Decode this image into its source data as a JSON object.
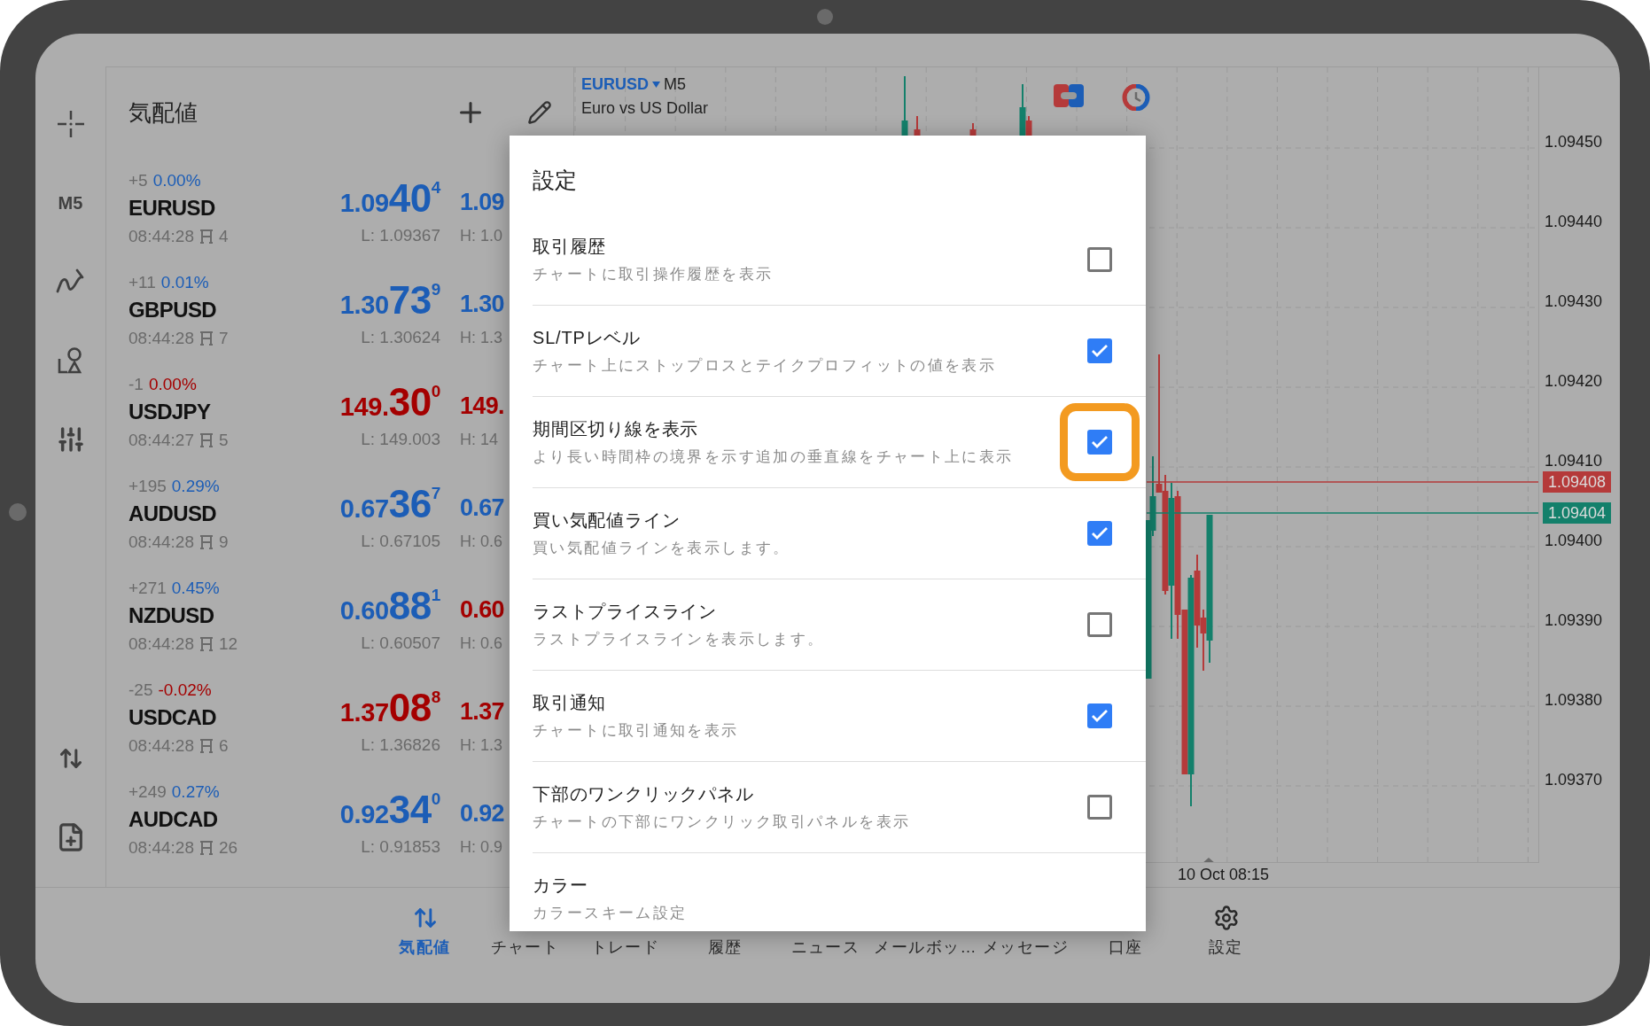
{
  "toolbar": {
    "timeframe": "M5"
  },
  "quotes": {
    "title": "気配値",
    "items": [
      {
        "symbol": "EURUSD",
        "change": {
          "points": "+5",
          "pct": "0.00%",
          "color": "#1c5db6"
        },
        "time": "08:44:28",
        "spread": "4",
        "bid": {
          "prefix": "1.09",
          "big": "40",
          "sup": "4",
          "color": "#1c5db6"
        },
        "low": "L: 1.09367",
        "ask": {
          "text": "1.09",
          "color": "#1c5db6"
        },
        "high": "H: 1.0"
      },
      {
        "symbol": "GBPUSD",
        "change": {
          "points": "+11",
          "pct": "0.01%",
          "color": "#1c5db6"
        },
        "time": "08:44:28",
        "spread": "7",
        "bid": {
          "prefix": "1.30",
          "big": "73",
          "sup": "9",
          "color": "#1c5db6"
        },
        "low": "L: 1.30624",
        "ask": {
          "text": "1.30",
          "color": "#1c5db6"
        },
        "high": "H: 1.3"
      },
      {
        "symbol": "USDJPY",
        "change": {
          "points": "-1",
          "pct": "0.00%",
          "color": "#a40000"
        },
        "time": "08:44:27",
        "spread": "5",
        "bid": {
          "prefix": "149.",
          "big": "30",
          "sup": "0",
          "color": "#a40000"
        },
        "low": "L: 149.003",
        "ask": {
          "text": "149.",
          "color": "#a40000"
        },
        "high": "H: 14"
      },
      {
        "symbol": "AUDUSD",
        "change": {
          "points": "+195",
          "pct": "0.29%",
          "color": "#1c5db6"
        },
        "time": "08:44:28",
        "spread": "9",
        "bid": {
          "prefix": "0.67",
          "big": "36",
          "sup": "7",
          "color": "#1c5db6"
        },
        "low": "L: 0.67105",
        "ask": {
          "text": "0.67",
          "color": "#1c5db6"
        },
        "high": "H: 0.6"
      },
      {
        "symbol": "NZDUSD",
        "change": {
          "points": "+271",
          "pct": "0.45%",
          "color": "#1c5db6"
        },
        "time": "08:44:28",
        "spread": "12",
        "bid": {
          "prefix": "0.60",
          "big": "88",
          "sup": "1",
          "color": "#1c5db6"
        },
        "low": "L: 0.60507",
        "ask": {
          "text": "0.60",
          "color": "#a40000"
        },
        "high": "H: 0.6"
      },
      {
        "symbol": "USDCAD",
        "change": {
          "points": "-25",
          "pct": "-0.02%",
          "color": "#a40000"
        },
        "time": "08:44:28",
        "spread": "6",
        "bid": {
          "prefix": "1.37",
          "big": "08",
          "sup": "8",
          "color": "#a40000"
        },
        "low": "L: 1.36826",
        "ask": {
          "text": "1.37",
          "color": "#a40000"
        },
        "high": "H: 1.3"
      },
      {
        "symbol": "AUDCAD",
        "change": {
          "points": "+249",
          "pct": "0.27%",
          "color": "#1c5db6"
        },
        "time": "08:44:28",
        "spread": "26",
        "bid": {
          "prefix": "0.92",
          "big": "34",
          "sup": "0",
          "color": "#1c5db6"
        },
        "low": "L: 0.91853",
        "ask": {
          "text": "0.92",
          "color": "#1c5db6"
        },
        "high": "H: 0.9"
      }
    ]
  },
  "chart": {
    "symbol": "EURUSD",
    "timeframe": "M5",
    "description": "Euro vs US Dollar",
    "price_axis": [
      "1.09450",
      "1.09440",
      "1.09430",
      "1.09420",
      "1.09410",
      "1.09400",
      "1.09390",
      "1.09380",
      "1.09370"
    ],
    "price_lines": [
      {
        "label": "1.09408",
        "color": "#b53a3a"
      },
      {
        "label": "1.09404",
        "color": "#13806b"
      }
    ],
    "time_label": "10 Oct 08:15"
  },
  "dialog": {
    "title": "設定",
    "items": [
      {
        "kind": "checkbox",
        "title": "取引履歴",
        "subtitle": "チャートに取引操作履歴を表示",
        "checked": false
      },
      {
        "kind": "checkbox",
        "title": "SL/TPレベル",
        "subtitle": "チャート上にストップロスとテイクプロフィットの値を表示",
        "checked": true
      },
      {
        "kind": "checkbox",
        "title": "期間区切り線を表示",
        "subtitle": "より長い時間枠の境界を示す追加の垂直線をチャート上に表示",
        "checked": true,
        "highlighted": true
      },
      {
        "kind": "checkbox",
        "title": "買い気配値ライン",
        "subtitle": "買い気配値ラインを表示します。",
        "checked": true
      },
      {
        "kind": "checkbox",
        "title": "ラストプライスライン",
        "subtitle": "ラストプライスラインを表示します。",
        "checked": false
      },
      {
        "kind": "checkbox",
        "title": "取引通知",
        "subtitle": "チャートに取引通知を表示",
        "checked": true
      },
      {
        "kind": "checkbox",
        "title": "下部のワンクリックパネル",
        "subtitle": "チャートの下部にワンクリック取引パネルを表示",
        "checked": false
      },
      {
        "kind": "link",
        "title": "カラー",
        "subtitle": "カラースキーム設定"
      }
    ]
  },
  "bottom_nav": [
    {
      "kind": "quotes",
      "label": "気配値",
      "selected": true
    },
    {
      "kind": "chart",
      "label": "チャート",
      "selected": false
    },
    {
      "kind": "trade",
      "label": "トレード",
      "selected": false
    },
    {
      "kind": "history",
      "label": "履歴",
      "selected": false
    },
    {
      "kind": "news",
      "label": "ニュース",
      "selected": false
    },
    {
      "kind": "mail",
      "label": "メールボッ…",
      "selected": false
    },
    {
      "kind": "messages",
      "label": "メッセージ",
      "selected": false
    },
    {
      "kind": "account",
      "label": "口座",
      "selected": false
    },
    {
      "kind": "settings",
      "label": "設定",
      "selected": false
    }
  ]
}
